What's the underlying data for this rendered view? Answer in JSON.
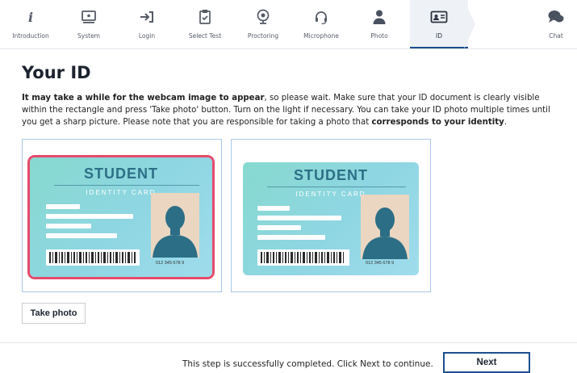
{
  "nav": {
    "steps": [
      {
        "label": "Introduction",
        "icon": "info-icon"
      },
      {
        "label": "System",
        "icon": "monitor-icon"
      },
      {
        "label": "Login",
        "icon": "login-icon"
      },
      {
        "label": "Select Test",
        "icon": "clipboard-check-icon"
      },
      {
        "label": "Proctoring",
        "icon": "webcam-icon"
      },
      {
        "label": "Microphone",
        "icon": "headset-icon"
      },
      {
        "label": "Photo",
        "icon": "person-icon"
      },
      {
        "label": "ID",
        "icon": "id-card-icon"
      }
    ],
    "active_step": "ID",
    "chat": {
      "label": "Chat",
      "icon": "chat-icon"
    }
  },
  "page": {
    "title": "Your ID",
    "intro_bold_1": "It may take a while for the webcam image to appear",
    "intro_text_1": ", so please wait. Make sure that your ID document is clearly visible within the rectangle and press 'Take photo' button. Turn on the light if necessary. You can take your ID photo multiple times until you get a sharp picture. Please note that you are responsible for taking a photo that ",
    "intro_bold_2": "corresponds to your identity",
    "intro_text_2": "."
  },
  "webcam_card": {
    "title": "STUDENT",
    "subtitle": "IDENTITY CARD",
    "number": "012 345 678 9"
  },
  "captured_card": {
    "title": "STUDENT",
    "subtitle": "IDENTITY CARD",
    "number": "012 345 678 9"
  },
  "actions": {
    "take_photo": "Take photo",
    "next": "Next"
  },
  "footer": {
    "status": "This step is successfully completed. Click Next to continue."
  },
  "colors": {
    "accent": "#1c4f8f",
    "frame": "#e64a6b",
    "panel_border": "#a9c7e6",
    "card_teal": "#86d9cf",
    "silhouette": "#2b6e86"
  }
}
